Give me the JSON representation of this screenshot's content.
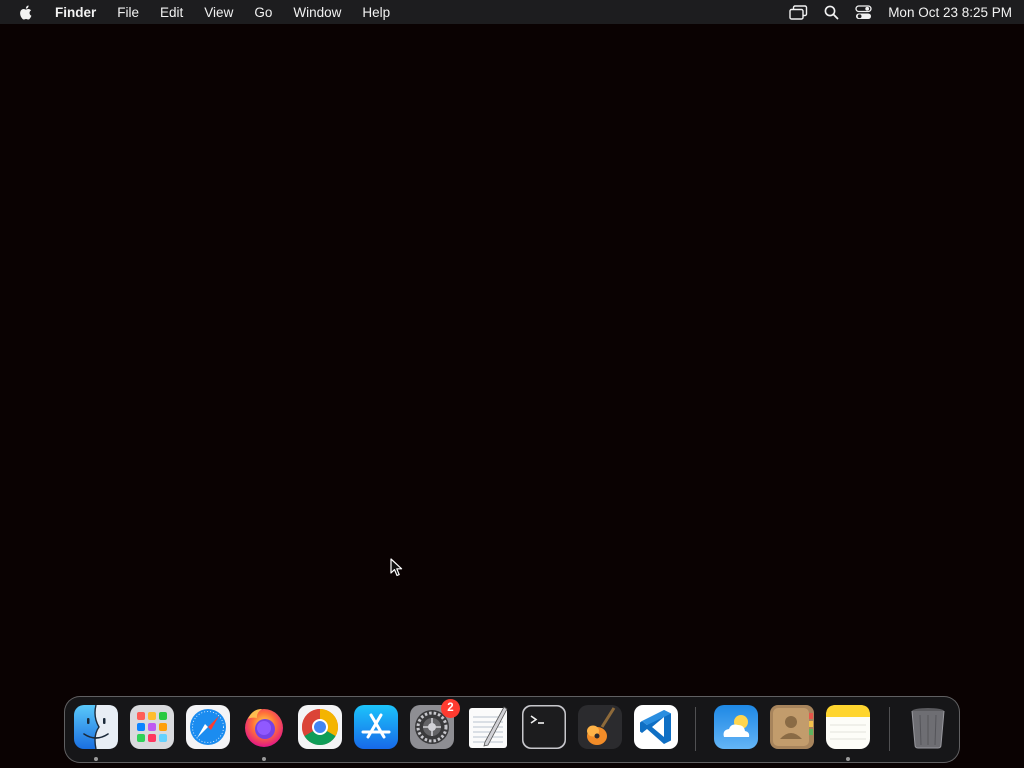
{
  "menubar": {
    "apple_icon": "apple-logo-icon",
    "app_name": "Finder",
    "menus": [
      "File",
      "Edit",
      "View",
      "Go",
      "Window",
      "Help"
    ],
    "status_icons": [
      "screen-mirroring-icon",
      "search-icon",
      "control-center-icon"
    ],
    "clock": "Mon Oct 23  8:25 PM"
  },
  "dock": {
    "apps": [
      {
        "name": "Finder",
        "icon": "finder-icon",
        "running": true
      },
      {
        "name": "Launchpad",
        "icon": "launchpad-icon",
        "running": false
      },
      {
        "name": "Safari",
        "icon": "safari-icon",
        "running": false
      },
      {
        "name": "Firefox",
        "icon": "firefox-icon",
        "running": true
      },
      {
        "name": "Google Chrome",
        "icon": "chrome-icon",
        "running": false
      },
      {
        "name": "App Store",
        "icon": "app-store-icon",
        "running": false
      },
      {
        "name": "System Settings",
        "icon": "system-settings-icon",
        "running": false,
        "badge": "2"
      },
      {
        "name": "TextEdit",
        "icon": "textedit-icon",
        "running": false
      },
      {
        "name": "Terminal",
        "icon": "terminal-icon",
        "running": false
      },
      {
        "name": "GarageBand",
        "icon": "garageband-icon",
        "running": false
      },
      {
        "name": "Visual Studio Code",
        "icon": "vscode-icon",
        "running": false
      },
      {
        "name": "Weather",
        "icon": "weather-icon",
        "running": false
      },
      {
        "name": "Contacts",
        "icon": "contacts-icon",
        "running": false
      },
      {
        "name": "Notes",
        "icon": "notes-icon",
        "running": true
      },
      {
        "name": "Trash",
        "icon": "trash-icon",
        "running": false
      }
    ]
  },
  "colors": {
    "desktop": "#0a0202",
    "menubar": "#1d1d1f",
    "badge": "#ff3b30"
  }
}
